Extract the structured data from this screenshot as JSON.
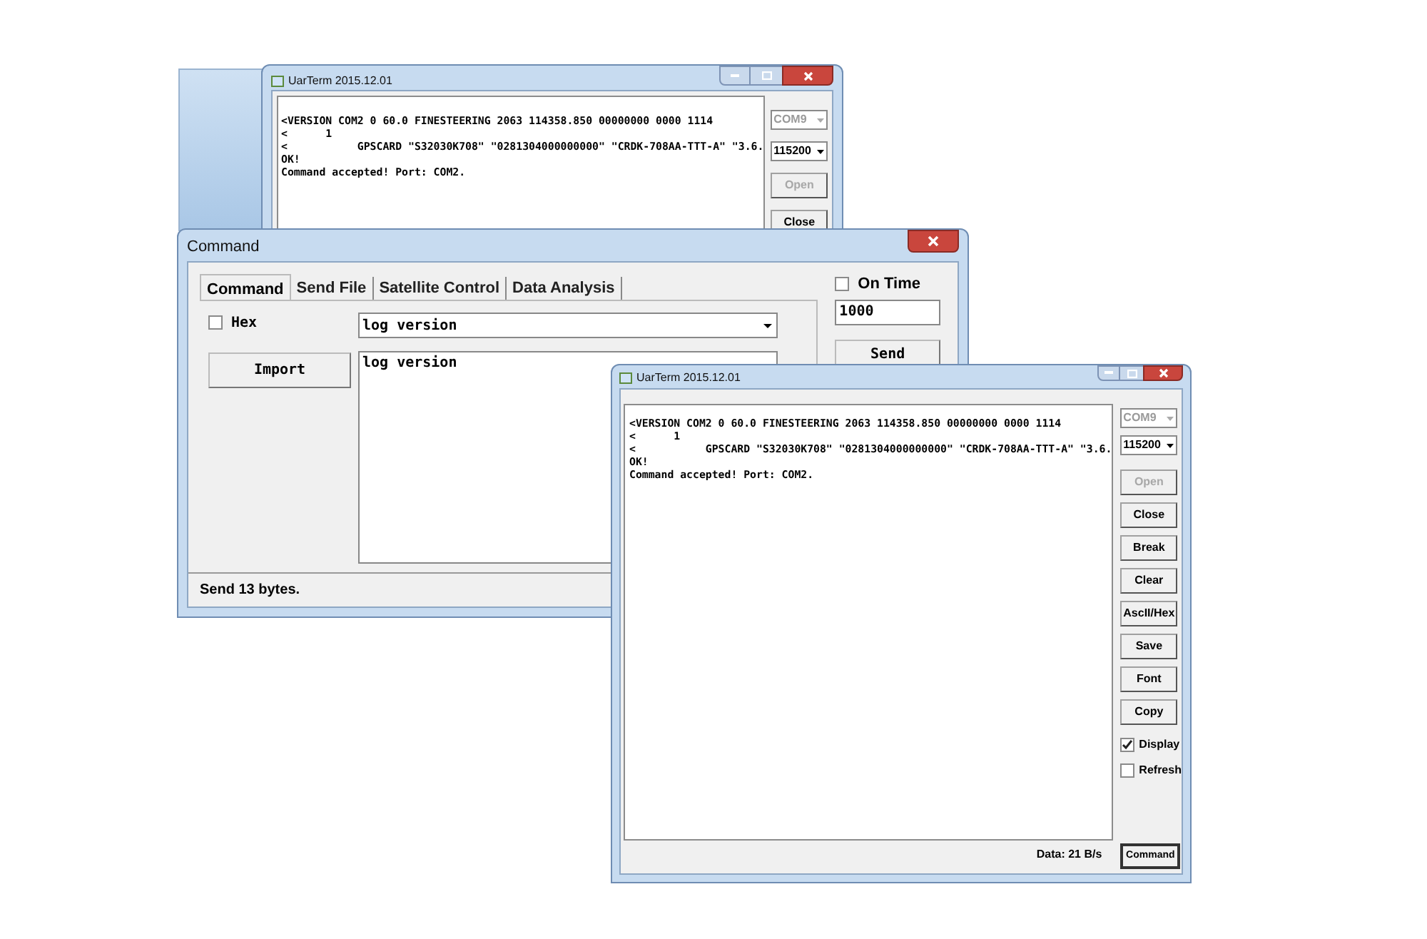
{
  "back_window": {
    "title": "UarTerm 2015.12.01",
    "terminal_lines": [
      "<VERSION COM2 0 60.0 FINESTEERING 2063 114358.850 00000000 0000 1114",
      "<      1",
      "<           GPSCARD \"S32030K708\" \"0281304000000000\" \"CRDK-708AA-TTT-A\" \"3.6.",
      "OK!",
      "Command accepted! Port: COM2."
    ],
    "port": "COM9",
    "baud": "115200",
    "buttons": [
      {
        "label": "Open",
        "disabled": true
      },
      {
        "label": "Close",
        "disabled": false
      }
    ]
  },
  "command_window": {
    "title": "Command",
    "tabs": [
      {
        "label": "Command",
        "selected": true
      },
      {
        "label": "Send File",
        "selected": false
      },
      {
        "label": "Satellite Control",
        "selected": false
      },
      {
        "label": "Data Analysis",
        "selected": false
      }
    ],
    "hex": {
      "label": "Hex",
      "checked": false
    },
    "command_select": "log version",
    "import_button": "Import",
    "command_text": "log version",
    "on_time": {
      "label": "On Time",
      "checked": false
    },
    "interval": "1000",
    "send_button": "Send",
    "status": "Send 13 bytes."
  },
  "front_window": {
    "title": "UarTerm 2015.12.01",
    "terminal_lines": [
      "<VERSION COM2 0 60.0 FINESTEERING 2063 114358.850 00000000 0000 1114",
      "<      1",
      "<           GPSCARD \"S32030K708\" \"0281304000000000\" \"CRDK-708AA-TTT-A\" \"3.6.",
      "OK!",
      "Command accepted! Port: COM2."
    ],
    "port": "COM9",
    "baud": "115200",
    "buttons": [
      {
        "label": "Open",
        "disabled": true
      },
      {
        "label": "Close",
        "disabled": false
      },
      {
        "label": "Break",
        "disabled": false
      },
      {
        "label": "Clear",
        "disabled": false
      },
      {
        "label": "AscII/Hex",
        "disabled": false
      },
      {
        "label": "Save",
        "disabled": false
      },
      {
        "label": "Font",
        "disabled": false
      },
      {
        "label": "Copy",
        "disabled": false
      }
    ],
    "checkboxes": [
      {
        "label": "Display",
        "checked": true
      },
      {
        "label": "Refresh",
        "checked": false
      }
    ],
    "data_rate": "Data: 21 B/s",
    "command_button": "Command"
  }
}
